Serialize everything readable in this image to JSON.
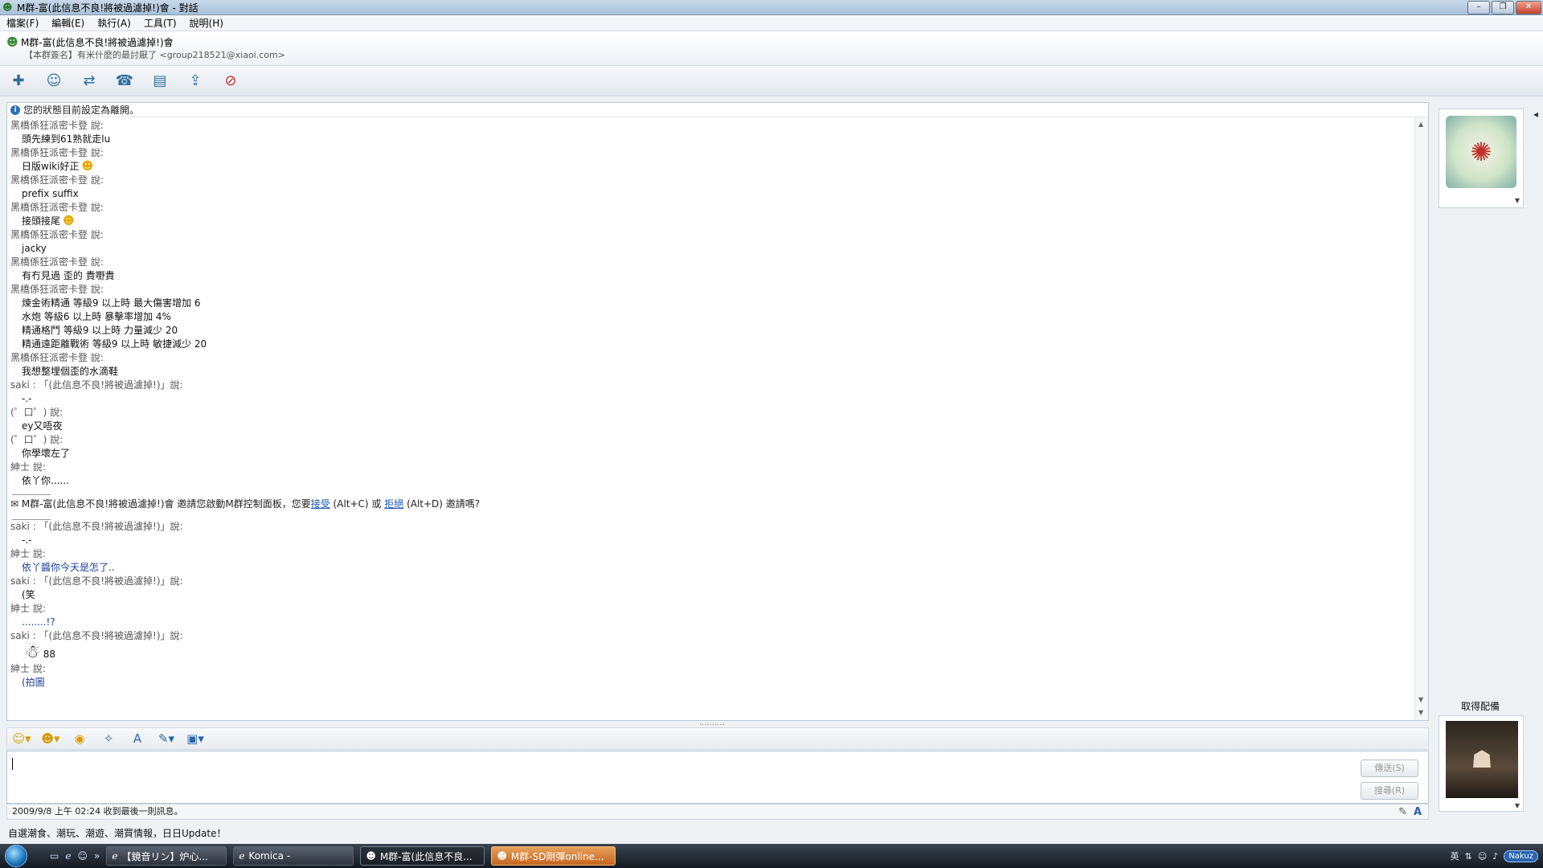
{
  "window": {
    "title": "M群-富(此信息不良!將被過濾掉!)會 - 對話"
  },
  "menu": [
    "檔案(F)",
    "編輯(E)",
    "執行(A)",
    "工具(T)",
    "說明(H)"
  ],
  "header": {
    "group_name": "M群-富(此信息不良!將被過濾掉!)會",
    "signature": "【本群簽名】有米什麼的最討厭了 <group218521@xiaoi.com>"
  },
  "toolbar_icons": [
    "add-contact-icon",
    "group-icon",
    "share-icon",
    "call-icon",
    "files-icon",
    "invite-icon",
    "block-icon"
  ],
  "chat": {
    "status_note": "您的狀態目前設定為離開。",
    "messages": [
      {
        "sender": "黑橋係狂派密卡登 說:",
        "lines": [
          "頭先練到61熟就走lu"
        ]
      },
      {
        "sender": "黑橋係狂派密卡登 說:",
        "lines": [
          "日版wiki好正"
        ],
        "emoji": "☻"
      },
      {
        "sender": "黑橋係狂派密卡登 說:",
        "lines": [
          "prefix suffix"
        ]
      },
      {
        "sender": "黑橋係狂派密卡登 說:",
        "lines": [
          "接頭接尾"
        ],
        "emoji": "☻"
      },
      {
        "sender": "黑橋係狂派密卡登 說:",
        "lines": [
          "jacky"
        ]
      },
      {
        "sender": "黑橋係狂派密卡登 說:",
        "lines": [
          "有冇見過 歪的 貴嘢貴"
        ]
      },
      {
        "sender": "黑橋係狂派密卡登 說:",
        "lines": [
          "煉金術精通 等級9 以上時 最大傷害增加 6",
          "水炮 等級6 以上時 暴擊率增加 4%",
          "精通格鬥 等級9 以上時 力量減少 20",
          "精通遠距離戰術 等級9 以上時 敏捷減少 20"
        ]
      },
      {
        "sender": "黑橋係狂派密卡登 說:",
        "lines": [
          "我想整埋個歪的水滴鞋"
        ]
      },
      {
        "sender": "saki : 「(此信息不良!將被過濾掉!)」說:",
        "lines": [
          "-.-"
        ]
      },
      {
        "sender": "(゜口゜) 說:",
        "lines": [
          "ey又唔夜"
        ]
      },
      {
        "sender": "(゜口゜) 說:",
        "lines": [
          "你學壞左了"
        ]
      },
      {
        "sender": "紳士 說:",
        "lines": [
          "依丫你......"
        ]
      }
    ],
    "invite": {
      "prefix": "M群-富(此信息不良!將被過濾掉!)會 邀請您啟動M群控制面板，您要",
      "accept": "接受",
      "middle": "(Alt+C) 或",
      "decline": "拒絕",
      "suffix": "(Alt+D) 邀請嗎?"
    },
    "messages2": [
      {
        "sender": "saki : 「(此信息不良!將被過濾掉!)」說:",
        "lines": [
          "-.-"
        ]
      },
      {
        "sender": "紳士 說:",
        "lines": [
          "依丫醬你今天是怎了.."
        ],
        "blue": true
      },
      {
        "sender": "saki : 「(此信息不良!將被過濾掉!)」說:",
        "lines": [
          "(笑"
        ]
      },
      {
        "sender": "紳士 說:",
        "lines": [
          "........!?"
        ],
        "blue": true
      },
      {
        "sender": "saki : 「(此信息不良!將被過濾掉!)」說:",
        "lines": [
          "88"
        ],
        "big": true
      },
      {
        "sender": "紳士 說:",
        "lines": [
          "(拍圖"
        ],
        "blue": true
      }
    ]
  },
  "format_icons": [
    "smile-icon",
    "wink-icon",
    "emoticon-icon",
    "nudge-icon",
    "font-icon",
    "pen-icon",
    "background-icon"
  ],
  "input": {
    "send_label": "傳送(S)",
    "hold_label": "搜尋(R)"
  },
  "status": {
    "last_message": "2009/9/8 上午 02:24 收到最後一則訊息。"
  },
  "ad_text": "自選潮食、潮玩、潮遊、潮買情報，日日Update！",
  "right_panel": {
    "get_picture_label": "取得配備"
  },
  "taskbar": {
    "tasks": [
      {
        "label": "【鏡音リン】炉心...",
        "icon": "ie-icon"
      },
      {
        "label": "Komica -",
        "icon": "ie-icon"
      },
      {
        "label": "M群-富(此信息不良...",
        "icon": "chat-icon",
        "active": true
      },
      {
        "label": "M群-SD剛彈online...",
        "icon": "chat-icon",
        "flash": true
      }
    ],
    "tray_logo": "Nakuz"
  }
}
